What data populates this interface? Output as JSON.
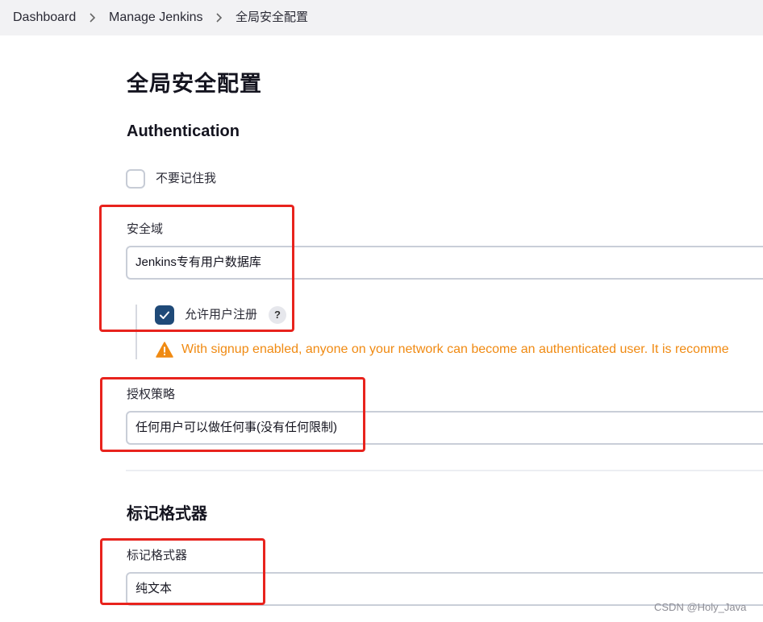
{
  "breadcrumb": {
    "items": [
      "Dashboard",
      "Manage Jenkins",
      "全局安全配置"
    ]
  },
  "page": {
    "title": "全局安全配置"
  },
  "authentication": {
    "heading": "Authentication",
    "remember_me_checkbox": {
      "label": "不要记住我",
      "checked": false
    },
    "security_realm": {
      "label": "安全域",
      "selected": "Jenkins专有用户数据库",
      "allow_signup_checkbox": {
        "label": "允许用户注册",
        "checked": true
      },
      "help": "?",
      "warning": "With signup enabled, anyone on your network can become an authenticated user. It is recomme"
    },
    "authorization_strategy": {
      "label": "授权策略",
      "selected": "任何用户可以做任何事(没有任何限制)"
    }
  },
  "markup_formatter": {
    "heading": "标记格式器",
    "label": "标记格式器",
    "selected": "纯文本"
  },
  "watermark": "CSDN @Holy_Java",
  "colors": {
    "accent_checkbox": "#1f4a78",
    "warning": "#f08a12",
    "annotation": "#e8231d",
    "breadcrumb_bg": "#f2f2f4"
  },
  "icons": {
    "separator": "chevron-right-icon",
    "checkmark": "check-icon",
    "warning": "warning-triangle-icon",
    "help": "help-icon"
  }
}
